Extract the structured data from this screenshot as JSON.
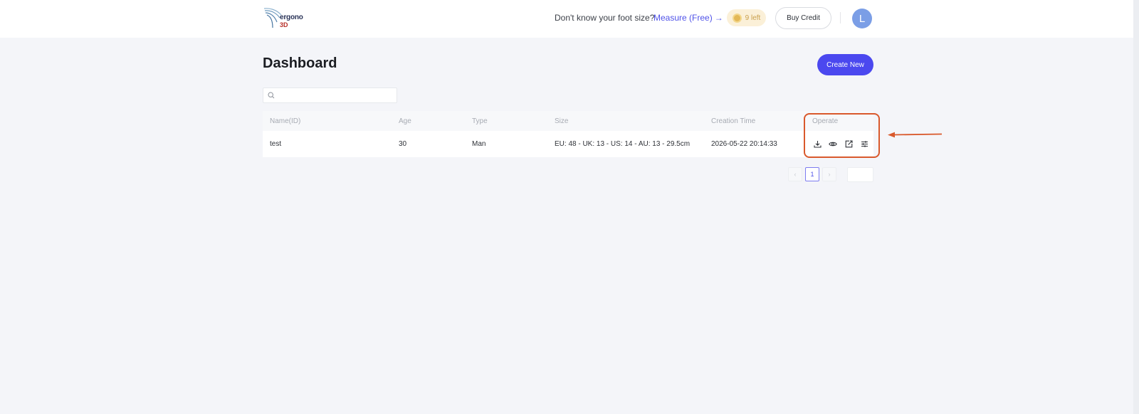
{
  "header": {
    "logo": {
      "word": "ergono",
      "suffix": "3D"
    },
    "foot_question": "Don't know your foot size?",
    "measure_link": "Measure (Free)",
    "measure_arrow": "→",
    "credits_left": "9 left",
    "buy_credit_label": "Buy Credit",
    "avatar_initial": "L"
  },
  "page": {
    "title": "Dashboard",
    "create_new_label": "Create New"
  },
  "search": {
    "value": "",
    "placeholder": ""
  },
  "table": {
    "columns": [
      "Name(ID)",
      "Age",
      "Type",
      "Size",
      "Creation Time",
      "Operate"
    ],
    "rows": [
      {
        "name": "test",
        "age": "30",
        "type": "Man",
        "size": "EU: 48 - UK: 13 - US: 14 - AU: 13 - 29.5cm",
        "created": "2026-05-22 20:14:33",
        "operations": [
          "download-icon",
          "view-icon",
          "export-icon",
          "adjust-icon"
        ]
      }
    ]
  },
  "pagination": {
    "prev": "‹",
    "current": "1",
    "next": "›"
  },
  "colors": {
    "accent": "#4b48ef",
    "link": "#4f52e8",
    "highlight": "#d9592c",
    "avatar": "#7b9ee6",
    "credit_badge": "#fbf0d8"
  }
}
